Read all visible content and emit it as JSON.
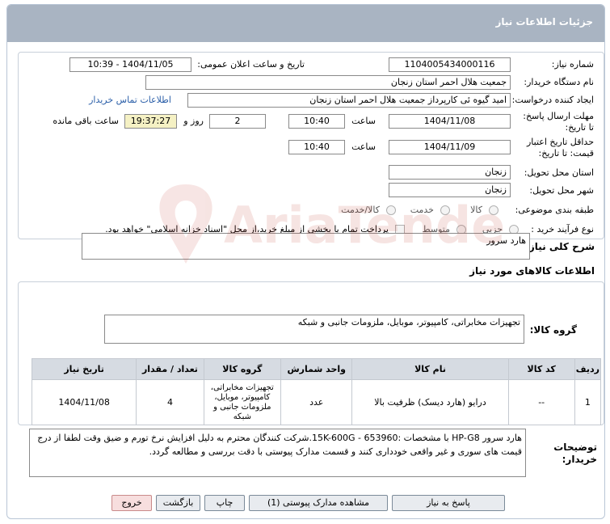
{
  "title": "جزئیات اطلاعات نیاز",
  "watermark_text": "AriaTender.net",
  "fields": {
    "need_number_label": "شماره نیاز:",
    "need_number": "1104005434000116",
    "announce_label": "تاریخ و ساعت اعلان عمومی:",
    "announce_value": "1404/11/05 - 10:39",
    "buyer_org_label": "نام دستگاه خریدار:",
    "buyer_org": "جمعیت هلال احمر استان زنجان",
    "creator_label": "ایجاد کننده درخواست:",
    "creator": "امید گیوه ئی کارپرداز  جمعیت هلال احمر استان زنجان",
    "contact_link": "اطلاعات تماس خریدار",
    "reply_deadline_label": "مهلت ارسال پاسخ: تا تاریخ:",
    "reply_date": "1404/11/08",
    "time_label": "ساعت",
    "reply_time": "10:40",
    "days_value": "2",
    "days_label": "روز و",
    "remaining_time": "19:37:27",
    "remaining_label": "ساعت باقی مانده",
    "price_validity_label": "حداقل تاریخ اعتبار قیمت: تا تاریخ:",
    "validity_date": "1404/11/09",
    "validity_time": "10:40",
    "province_label": "استان محل تحویل:",
    "province": "زنجان",
    "city_label": "شهر محل تحویل:",
    "city": "زنجان",
    "category_label": "طبقه بندی موضوعی:",
    "category_options": [
      "کالا",
      "خدمت",
      "کالا/خدمت"
    ],
    "purchase_type_label": "نوع فرآیند خرید :",
    "purchase_options": [
      "جزیی",
      "متوسط"
    ],
    "payment_note": "پرداخت تمام یا بخشی از مبلغ خرید،از محل \"اسناد خزانه اسلامی\" خواهد بود."
  },
  "general_desc_label": "شرح کلی نیاز:",
  "general_desc": "هارد سرور",
  "goods_info_title": "اطلاعات کالاهای مورد نیاز",
  "goods_group_label": "گروه کالا:",
  "goods_group": "تجهیزات مخابراتی، کامپیوتر، موبایل، ملزومات جانبی و شبکه",
  "table": {
    "headers": [
      "ردیف",
      "کد کالا",
      "نام کالا",
      "واحد شمارش",
      "گروه کالا",
      "تعداد / مقدار",
      "تاریخ نیاز"
    ],
    "rows": [
      {
        "index": "1",
        "code": "--",
        "name": "درایو (هارد دیسک) ظرفیت بالا",
        "unit": "عدد",
        "group": "تجهیزات مخابراتی، کامپیوتر، موبایل، ملزومات جانبی و شبکه",
        "qty": "4",
        "date": "1404/11/08"
      }
    ]
  },
  "buyer_notes_label": "توضیحات خریدار:",
  "buyer_notes": "هارد سرور HP-G8 با مشخصات :653960 - 15K-600G.شرکت کنندگان محترم به دلیل افزایش نرخ تورم و ضیق وقت لطفا از درج قیمت های سوری و غیر واقعی خودداری کنند و قسمت مدارک پیوستی با دقت بررسی و مطالعه گردد.",
  "buttons": {
    "reply": "پاسخ به نیاز",
    "attachments": "مشاهده مدارک پیوستی (1)",
    "print": "چاپ",
    "back": "بازگشت",
    "exit": "خروج"
  }
}
